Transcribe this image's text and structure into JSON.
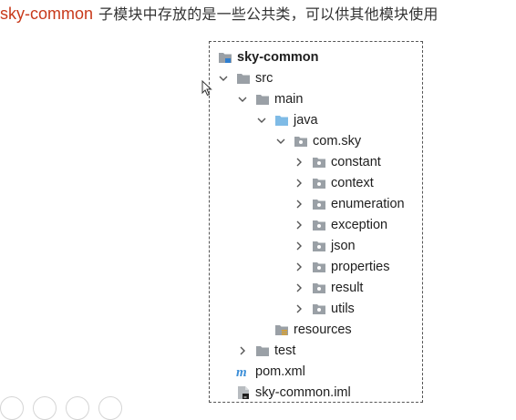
{
  "heading": {
    "module": "sky-common",
    "description": "子模块中存放的是一些公共类，可以供其他模块使用"
  },
  "tree": {
    "root": "sky-common",
    "src": "src",
    "main": "main",
    "java": "java",
    "package": "com.sky",
    "subpackages": [
      "constant",
      "context",
      "enumeration",
      "exception",
      "json",
      "properties",
      "result",
      "utils"
    ],
    "resources": "resources",
    "test": "test",
    "pom": "pom.xml",
    "iml": "sky-common.iml"
  },
  "colors": {
    "module_text": "#c8391a",
    "folder_gray": "#9aa0a6",
    "folder_blue": "#7fbbe6",
    "maven_blue": "#3d8fd8"
  }
}
